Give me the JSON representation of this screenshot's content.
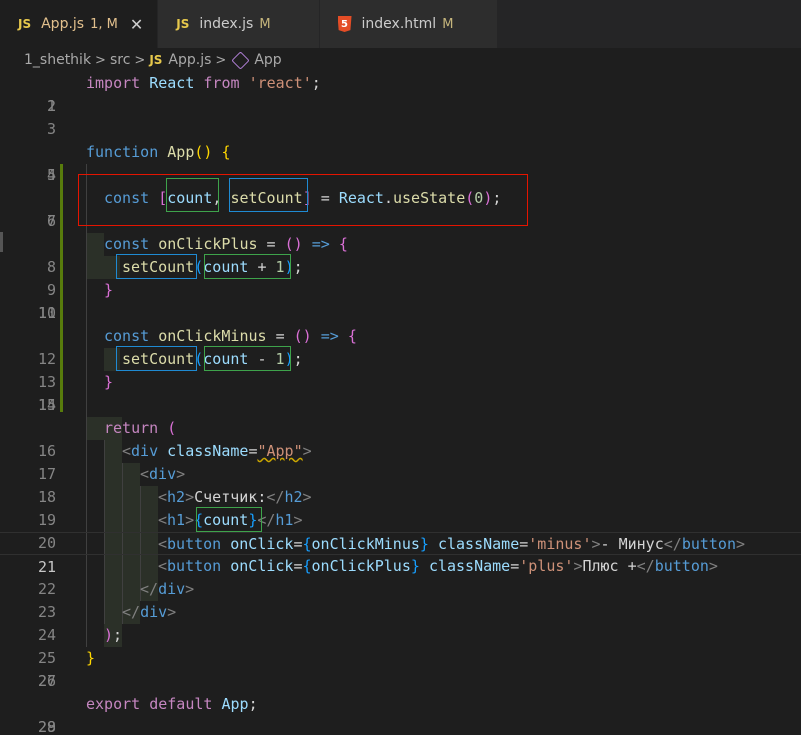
{
  "tabs": [
    {
      "icon": "JS",
      "name": "App.js",
      "status": "1, M",
      "active": true
    },
    {
      "icon": "JS",
      "name": "index.js",
      "status": "M",
      "active": false
    },
    {
      "icon": "5",
      "name": "index.html",
      "status": "M",
      "active": false
    }
  ],
  "breadcrumb": {
    "folder": "1_shethik",
    "sub": "src",
    "file_icon": "JS",
    "file": "App.js",
    "symbol": "App"
  },
  "editor": {
    "current_line": 21,
    "line_numbers": [
      "1",
      "2",
      "3",
      "4",
      "5",
      "6",
      "7",
      "8",
      "9",
      "10",
      "11",
      "12",
      "13",
      "14",
      "15",
      "16",
      "17",
      "18",
      "19",
      "20",
      "21",
      "22",
      "23",
      "24",
      "25",
      "26",
      "27",
      "28",
      "29"
    ],
    "t": {
      "import": "import",
      "React": "React",
      "from": "from",
      "react_str": "'react'",
      "semi": ";",
      "function": "function",
      "App": "App",
      "parens": "()",
      "lbrace": "{",
      "rbrace": "}",
      "const": "const",
      "lbr": "[",
      "rbr": "]",
      "count": "count",
      "comma": ",",
      "setCount": "setCount",
      "eq": " = ",
      "dot": ".",
      "useState": "useState",
      "lp": "(",
      "rp": ")",
      "zero": "0",
      "onClickPlus": "onClickPlus",
      "onClickMinus": "onClickMinus",
      "arrowEq": " = ",
      "arrow": " => ",
      "plus1": " + ",
      "minus1": " - ",
      "one": "1",
      "return": "return",
      "lt": "<",
      "gt": ">",
      "lts": "</",
      "div": "div",
      "className": "className",
      "eqs": "=",
      "App_str": "\"App\"",
      "h2": "h2",
      "h2text": "Счетчик:",
      "h1": "h1",
      "button": "button",
      "onClick": "onClick",
      "minus_str": "'minus'",
      "minus_text": "- Минус",
      "plus_str": "'plus'",
      "plus_text": "Плюс +",
      "export": "export",
      "default": "default",
      "sp": " "
    }
  }
}
